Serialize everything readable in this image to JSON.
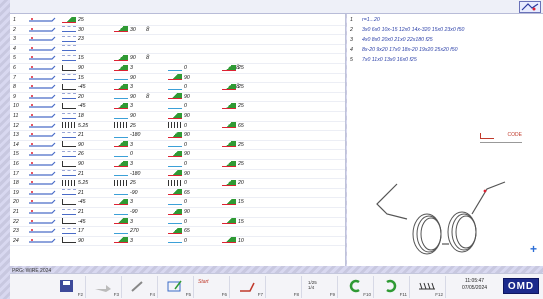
{
  "program_label": "PRG: WIRE 2024",
  "rows": [
    {
      "n": "1",
      "c1": {
        "icon": "bend",
        "val": "25"
      }
    },
    {
      "n": "2",
      "c1": {
        "icon": "feed",
        "val": "30"
      },
      "c2": {
        "icon": "bend",
        "val": "30"
      },
      "zzz": "8"
    },
    {
      "n": "3",
      "c1": {
        "icon": "feed",
        "val": "23"
      }
    },
    {
      "n": "4",
      "c1": {
        "icon": "feed",
        "val": ""
      }
    },
    {
      "n": "5",
      "c1": {
        "icon": "feed",
        "val": "15"
      },
      "c2": {
        "icon": "bend",
        "val": "90"
      },
      "zzz": "8"
    },
    {
      "n": "6",
      "c1": {
        "icon": "ang",
        "val": "90"
      },
      "c2": {
        "icon": "bend",
        "val": "3"
      },
      "c3": {
        "icon": "rot",
        "val": "0"
      },
      "c4": {
        "icon": "bend",
        "val": "25"
      },
      "zzz2": "8"
    },
    {
      "n": "7",
      "c1": {
        "icon": "feed",
        "val": "15"
      },
      "c2": {
        "icon": "rot",
        "val": "90"
      },
      "c3": {
        "icon": "bend",
        "val": "90"
      }
    },
    {
      "n": "8",
      "c1": {
        "icon": "ang",
        "val": "-45"
      },
      "c2": {
        "icon": "bend",
        "val": "3"
      },
      "c3": {
        "icon": "rot",
        "val": "0"
      },
      "c4": {
        "icon": "bend",
        "val": "25"
      },
      "zzz2": "8"
    },
    {
      "n": "9",
      "c1": {
        "icon": "feed",
        "val": "20"
      },
      "c2": {
        "icon": "rot",
        "val": "90"
      },
      "c3": {
        "icon": "bend",
        "val": "90"
      },
      "zzz": "8"
    },
    {
      "n": "10",
      "c1": {
        "icon": "ang",
        "val": "-45"
      },
      "c2": {
        "icon": "bend",
        "val": "3"
      },
      "c3": {
        "icon": "rot",
        "val": "0"
      },
      "c4": {
        "icon": "bend",
        "val": "25"
      }
    },
    {
      "n": "11",
      "c1": {
        "icon": "feed",
        "val": "18"
      },
      "c2": {
        "icon": "rot",
        "val": "90"
      },
      "c3": {
        "icon": "bend",
        "val": "90"
      }
    },
    {
      "n": "12",
      "c1": {
        "icon": "wave",
        "val": "5.25"
      },
      "c2": {
        "icon": "wave",
        "val": "25"
      },
      "c3": {
        "icon": "wave",
        "val": "0"
      },
      "c4": {
        "icon": "bend",
        "val": "65"
      }
    },
    {
      "n": "13",
      "c1": {
        "icon": "feed",
        "val": "21"
      },
      "c2": {
        "icon": "rot",
        "val": "-180"
      },
      "c3": {
        "icon": "bend",
        "val": "90"
      }
    },
    {
      "n": "14",
      "c1": {
        "icon": "ang",
        "val": "90"
      },
      "c2": {
        "icon": "bend",
        "val": "3"
      },
      "c3": {
        "icon": "rot",
        "val": "0"
      },
      "c4": {
        "icon": "bend",
        "val": "25"
      }
    },
    {
      "n": "15",
      "c1": {
        "icon": "feed",
        "val": "26"
      },
      "c2": {
        "icon": "rot",
        "val": "0"
      },
      "c3": {
        "icon": "bend",
        "val": "90"
      }
    },
    {
      "n": "16",
      "c1": {
        "icon": "ang",
        "val": "90"
      },
      "c2": {
        "icon": "bend",
        "val": "3"
      },
      "c3": {
        "icon": "rot",
        "val": "0"
      },
      "c4": {
        "icon": "bend",
        "val": "25"
      }
    },
    {
      "n": "17",
      "c1": {
        "icon": "feed",
        "val": "21"
      },
      "c2": {
        "icon": "rot",
        "val": "-180"
      },
      "c3": {
        "icon": "bend",
        "val": "90"
      }
    },
    {
      "n": "18",
      "c1": {
        "icon": "wave",
        "val": "5.25"
      },
      "c2": {
        "icon": "wave",
        "val": "25"
      },
      "c3": {
        "icon": "wave",
        "val": "0"
      },
      "c4": {
        "icon": "bend",
        "val": "20"
      }
    },
    {
      "n": "19",
      "c1": {
        "icon": "feed",
        "val": "21"
      },
      "c2": {
        "icon": "rot",
        "val": "-90"
      },
      "c3": {
        "icon": "bend",
        "val": "65"
      }
    },
    {
      "n": "20",
      "c1": {
        "icon": "ang",
        "val": "-45"
      },
      "c2": {
        "icon": "bend",
        "val": "3"
      },
      "c3": {
        "icon": "rot",
        "val": "0"
      },
      "c4": {
        "icon": "bend",
        "val": "15"
      }
    },
    {
      "n": "21",
      "c1": {
        "icon": "feed",
        "val": "21"
      },
      "c2": {
        "icon": "rot",
        "val": "-90"
      },
      "c3": {
        "icon": "bend",
        "val": "90"
      }
    },
    {
      "n": "22",
      "c1": {
        "icon": "ang",
        "val": "-45"
      },
      "c2": {
        "icon": "bend",
        "val": "3"
      },
      "c3": {
        "icon": "rot",
        "val": "0"
      },
      "c4": {
        "icon": "bend",
        "val": "15"
      }
    },
    {
      "n": "23",
      "c1": {
        "icon": "feed",
        "val": "17"
      },
      "c2": {
        "icon": "rot",
        "val": "270"
      },
      "c3": {
        "icon": "bend",
        "val": "65"
      }
    },
    {
      "n": "24",
      "c1": {
        "icon": "ang",
        "val": "90"
      },
      "c2": {
        "icon": "bend",
        "val": "3"
      },
      "c3": {
        "icon": "rot",
        "val": "0"
      },
      "c4": {
        "icon": "bend",
        "val": "10"
      }
    }
  ],
  "right_list": [
    {
      "n": "1",
      "text": "r=1...20"
    },
    {
      "n": "2",
      "text": "3x0 6x0 10x-15 12x0 14x-320 15x0 23x0 f50"
    },
    {
      "n": "3",
      "text": "4x0 8x0 20x0 21x0 22x180 f25"
    },
    {
      "n": "4",
      "text": "8x-20 9x20 17x0 18x-20 19x20 25x20 f50"
    },
    {
      "n": "5",
      "text": "7x0 11x0 13x0 16x0 f25"
    }
  ],
  "code_label": "CODE",
  "toolbar": {
    "keys": [
      "F2",
      "F3",
      "F4",
      "F5",
      "F6",
      "F7",
      "F8",
      "F9",
      "F10",
      "F11",
      "F12"
    ],
    "start_label": "Start",
    "clock_time": "11:05:47",
    "clock_date": "07/05/2024",
    "logo": "OMD"
  },
  "colors": {
    "accent": "#1b2a8c",
    "feed": "#4a6cc8",
    "bend": "#2f9a34",
    "rot": "#3ca0d8",
    "code": "#c0392b"
  }
}
